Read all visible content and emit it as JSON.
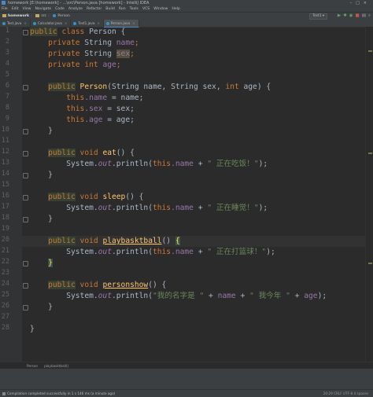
{
  "window": {
    "title": "homework [E:\\homework] - ...\\src\\Person.java [homework] - IntelliJ IDEA"
  },
  "menu": [
    "File",
    "Edit",
    "View",
    "Navigate",
    "Code",
    "Analyze",
    "Refactor",
    "Build",
    "Run",
    "Tools",
    "VCS",
    "Window",
    "Help"
  ],
  "navigation": {
    "project": "homework",
    "folder": "src",
    "file": "Person"
  },
  "toolbar": {
    "run_config": "Test1"
  },
  "tabs": [
    {
      "label": "Test.java",
      "active": false
    },
    {
      "label": "Calculator.java",
      "active": false
    },
    {
      "label": "Test1.java",
      "active": false
    },
    {
      "label": "Person.java",
      "active": true
    }
  ],
  "code": {
    "line_numbers": [
      "1",
      "2",
      "3",
      "4",
      "5",
      "6",
      "7",
      "8",
      "9",
      "10",
      "11",
      "12",
      "13",
      "14",
      "15",
      "16",
      "17",
      "18",
      "19",
      "20",
      "21",
      "22",
      "23",
      "24",
      "25",
      "26",
      "27",
      "28"
    ],
    "l1": {
      "kw1": "public",
      "kw2": "class",
      "rest": " Person {"
    },
    "l2": {
      "kw": "private",
      "type": " String ",
      "field": "name",
      ";": ";"
    },
    "l3": {
      "kw": "private",
      "type": " String ",
      "field": "sex",
      "semi": ";"
    },
    "l4": {
      "kw": "private",
      "type": " int ",
      "field": "age",
      "semi": ";"
    },
    "l6": {
      "kw": "public",
      "name": " Person",
      "p1": "(String name, String sex, ",
      "kwint": "int",
      "p2": " age) {"
    },
    "l7": {
      "kw": "this",
      "field": ".name",
      "rest": " = name;"
    },
    "l8": {
      "kw": "this",
      "field": ".sex",
      "rest": " = sex;"
    },
    "l9": {
      "kw": "this",
      "field": ".age",
      "rest": " = age;"
    },
    "l10": "}",
    "l12": {
      "kw": "public",
      "kw2": "void",
      "m": "eat",
      "rest": "() {"
    },
    "l13": {
      "pre": "System.",
      "out": "out",
      "mid": ".println(",
      "kw": "this",
      "field": ".name",
      "plus": " + ",
      "str": "\" 正在吃饭！\"",
      "end": ");"
    },
    "l14": "}",
    "l16": {
      "kw": "public",
      "kw2": "void",
      "m": "sleep",
      "rest": "() {"
    },
    "l17": {
      "pre": "System.",
      "out": "out",
      "mid": ".println(",
      "kw": "this",
      "field": ".name",
      "plus": " + ",
      "str": "\" 正在睡觉！\"",
      "end": ");"
    },
    "l18": "}",
    "l20": {
      "kw": "public",
      "kw2": "void",
      "m": "playbasktball",
      "paren": "() ",
      "brace": "{"
    },
    "l21": {
      "pre": "System.",
      "out": "out",
      "mid": ".println(",
      "kw": "this",
      "field": ".name",
      "plus": " + ",
      "str": "\" 正在打篮球！\"",
      "end": ");"
    },
    "l22": "}",
    "l24": {
      "kw": "public",
      "kw2": "void",
      "m": "personshow",
      "rest": "() {"
    },
    "l25": {
      "pre": "System.",
      "out": "out",
      "mid": ".println(",
      "str1": "\"我的名字是 \"",
      "plus1": " + ",
      "f1": "name",
      "plus2": " + ",
      "str2": "\" 我今年 \"",
      "plus3": " + ",
      "f2": "age",
      "end": ");"
    },
    "l26": "}",
    "l28": "}"
  },
  "breadcrumbs": [
    "Person",
    "playbasktball()"
  ],
  "status": {
    "message": "Compilation completed successfully in 1 s 146 ms (a minute ago)",
    "position": "20:29  CRLF  UTF-8  4 spaces"
  },
  "colors": {
    "keyword": "#cc7832",
    "field": "#9876aa",
    "method": "#ffc66d",
    "string": "#6a8759",
    "text": "#a9b7c6",
    "background": "#2b2b2b"
  }
}
